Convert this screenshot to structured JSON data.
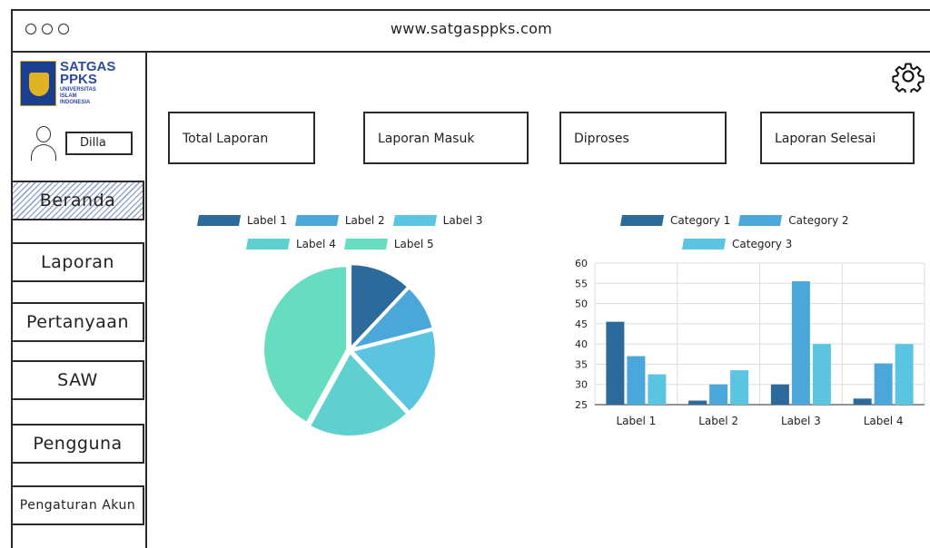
{
  "browser": {
    "url": "www.satgasppks.com"
  },
  "logo": {
    "line1": "SATGAS",
    "line2": "PPKS",
    "sub1": "UNIVERSITAS",
    "sub2": "ISLAM",
    "sub3": "INDONESIA"
  },
  "user": {
    "name": "Dilla"
  },
  "sidebar": {
    "items": [
      {
        "label": "Beranda"
      },
      {
        "label": "Laporan"
      },
      {
        "label": "Pertanyaan"
      },
      {
        "label": "SAW"
      },
      {
        "label": "Pengguna"
      },
      {
        "label": "Pengaturan Akun"
      }
    ]
  },
  "cards": [
    {
      "label": "Total Laporan"
    },
    {
      "label": "Laporan Masuk"
    },
    {
      "label": "Diproses"
    },
    {
      "label": "Laporan Selesai"
    }
  ],
  "icons": {
    "settings": "gear-icon",
    "user": "user-icon"
  },
  "chart_data": [
    {
      "type": "pie",
      "title": "",
      "legend_placement": "top",
      "categories": [
        "Label 1",
        "Label 2",
        "Label 3",
        "Label 4",
        "Label 5"
      ],
      "values": [
        12,
        9,
        17,
        20,
        42
      ],
      "colors": [
        "#2b6a9b",
        "#4ba6d9",
        "#5bc4e0",
        "#5fd0d0",
        "#66dcc0"
      ]
    },
    {
      "type": "bar",
      "title": "",
      "legend_placement": "top",
      "categories": [
        "Label 1",
        "Label 2",
        "Label 3",
        "Label 4"
      ],
      "series": [
        {
          "name": "Category 1",
          "values": [
            45.5,
            26,
            30,
            26.5
          ],
          "color": "#2b6a9b"
        },
        {
          "name": "Category 2",
          "values": [
            37,
            30,
            55.5,
            35.2
          ],
          "color": "#4ba6d9"
        },
        {
          "name": "Category 3",
          "values": [
            32.5,
            33.5,
            40,
            40
          ],
          "color": "#5bc4e0"
        }
      ],
      "ylim": [
        25,
        60
      ],
      "yticks": [
        25,
        30,
        35,
        40,
        45,
        50,
        55,
        60
      ],
      "grid": true
    }
  ]
}
